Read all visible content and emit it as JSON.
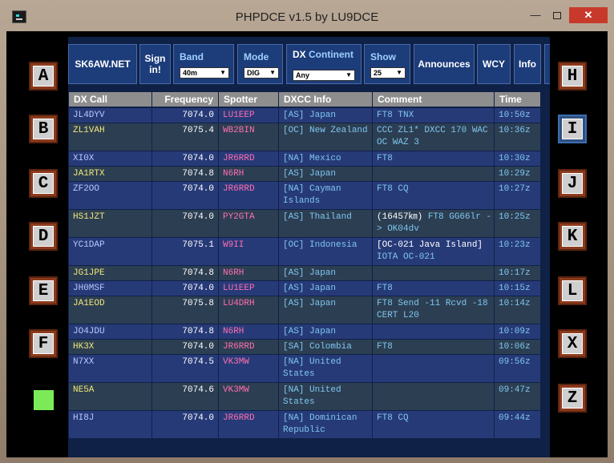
{
  "window": {
    "title": "PHPDCE v1.5 by LU9DCE",
    "minimize_label": "—",
    "close_label": "✕"
  },
  "left_keys": [
    "A",
    "B",
    "C",
    "D",
    "E",
    "F"
  ],
  "right_keys": [
    "H",
    "I",
    "J",
    "K",
    "L",
    "X",
    "Z"
  ],
  "active_key": "I",
  "colors": {
    "panel_bg": "#0f2147",
    "button_bg": "#1c3c7a",
    "row_blue": "#273a78",
    "row_gray": "#2c3e52",
    "spotter": "#ff6fb0",
    "info": "#7fc7f0",
    "call_yellow": "#f0e87a",
    "call_blue": "#b8c8ff",
    "status_green": "#7cea58"
  },
  "menu": {
    "site": "SK6AW.NET",
    "signin": "Sign in!",
    "band_label": "Band",
    "band_value": "40m",
    "mode_label": "Mode",
    "mode_value": "DIG",
    "dx_label": "DX",
    "continent_label": "Continent",
    "continent_value": "Any",
    "show_label": "Show",
    "show_value": "25",
    "announces": "Announces",
    "wcy": "WCY",
    "info": "Info"
  },
  "columns": [
    "DX Call",
    "Frequency",
    "Spotter",
    "DXCC Info",
    "Comment",
    "Time"
  ],
  "rows": [
    {
      "call": "JL4DYV",
      "freq": "7074.0",
      "spotter": "LU1EEP",
      "dxcc": "[AS] Japan",
      "comment": "FT8 TNX",
      "comment_extra": "",
      "time": "10:50z"
    },
    {
      "call": "ZL1VAH",
      "freq": "7075.4",
      "spotter": "WB2BIN",
      "dxcc": "[OC] New Zealand",
      "comment": "CCC ZL1* DXCC 170 WAC OC WAZ 3",
      "comment_extra": "",
      "time": "10:36z"
    },
    {
      "call": "XI0X",
      "freq": "7074.0",
      "spotter": "JR6RRD",
      "dxcc": "[NA] Mexico",
      "comment": "FT8",
      "comment_extra": "",
      "time": "10:30z"
    },
    {
      "call": "JA1RTX",
      "freq": "7074.8",
      "spotter": "N6RH",
      "dxcc": "[AS] Japan",
      "comment": "",
      "comment_extra": "",
      "time": "10:29z"
    },
    {
      "call": "ZF2OO",
      "freq": "7074.0",
      "spotter": "JR6RRD",
      "dxcc": "[NA] Cayman Islands",
      "comment": "FT8 CQ",
      "comment_extra": "",
      "time": "10:27z"
    },
    {
      "call": "HS1JZT",
      "freq": "7074.0",
      "spotter": "PY2GTA",
      "dxcc": "[AS] Thailand",
      "comment": "(16457㎞)",
      "comment_extra": " FT8 GG66lr -> OK04dv",
      "time": "10:25z"
    },
    {
      "call": "YC1DAP",
      "freq": "7075.1",
      "spotter": "W9II",
      "dxcc": "[OC] Indonesia",
      "comment": "[OC-021 Java Island]",
      "comment_extra": " IOTA OC-021",
      "time": "10:23z"
    },
    {
      "call": "JG1JPE",
      "freq": "7074.8",
      "spotter": "N6RH",
      "dxcc": "[AS] Japan",
      "comment": "",
      "comment_extra": "",
      "time": "10:17z"
    },
    {
      "call": "JH0MSF",
      "freq": "7074.0",
      "spotter": "LU1EEP",
      "dxcc": "[AS] Japan",
      "comment": "FT8",
      "comment_extra": "",
      "time": "10:15z"
    },
    {
      "call": "JA1EOD",
      "freq": "7075.8",
      "spotter": "LU4DRH",
      "dxcc": "[AS] Japan",
      "comment": "FT8 Send -11 Rcvd -18 CERT L20",
      "comment_extra": "",
      "time": "10:14z"
    },
    {
      "call": "JO4JDU",
      "freq": "7074.8",
      "spotter": "N6RH",
      "dxcc": "[AS] Japan",
      "comment": "",
      "comment_extra": "",
      "time": "10:09z"
    },
    {
      "call": "HK3X",
      "freq": "7074.0",
      "spotter": "JR6RRD",
      "dxcc": "[SA] Colombia",
      "comment": "FT8",
      "comment_extra": "",
      "time": "10:06z"
    },
    {
      "call": "N7XX",
      "freq": "7074.5",
      "spotter": "VK3MW",
      "dxcc": "[NA] United States",
      "comment": "",
      "comment_extra": "",
      "time": "09:56z"
    },
    {
      "call": "NE5A",
      "freq": "7074.6",
      "spotter": "VK3MW",
      "dxcc": "[NA] United States",
      "comment": "",
      "comment_extra": "",
      "time": "09:47z"
    },
    {
      "call": "HI8J",
      "freq": "7074.0",
      "spotter": "JR6RRD",
      "dxcc": "[NA] Dominican Republic",
      "comment": "FT8 CQ",
      "comment_extra": "",
      "time": "09:44z"
    }
  ]
}
